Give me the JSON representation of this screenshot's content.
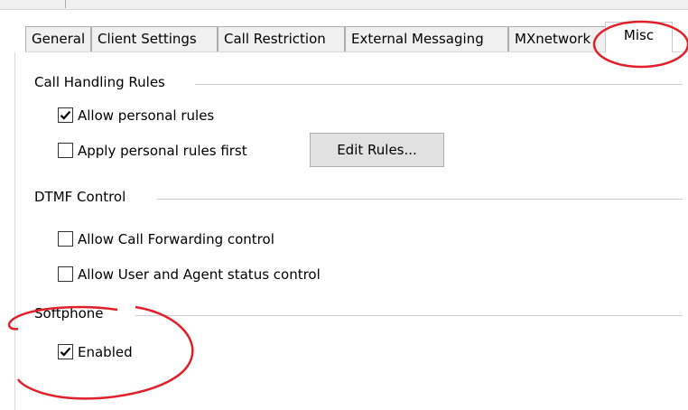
{
  "tabs": [
    {
      "label": "General"
    },
    {
      "label": "Client Settings"
    },
    {
      "label": "Call Restriction"
    },
    {
      "label": "External Messaging"
    },
    {
      "label": "MXnetwork"
    },
    {
      "label": "Misc"
    }
  ],
  "active_tab": "Misc",
  "groups": {
    "call_handling": {
      "title": "Call Handling Rules",
      "allow_personal_rules": {
        "label": "Allow personal rules",
        "checked": true
      },
      "apply_personal_rules_first": {
        "label": "Apply personal rules first",
        "checked": false
      },
      "edit_rules_button": "Edit Rules..."
    },
    "dtmf": {
      "title": "DTMF Control",
      "allow_call_forwarding": {
        "label": "Allow Call Forwarding control",
        "checked": false
      },
      "allow_user_agent_status": {
        "label": "Allow User and Agent status control",
        "checked": false
      }
    },
    "softphone": {
      "title": "Softphone",
      "enabled": {
        "label": "Enabled",
        "checked": true
      }
    }
  },
  "colors": {
    "annotation": "#e0202a",
    "tab_background": "#f0f0f0",
    "button_background": "#e1e1e1"
  }
}
